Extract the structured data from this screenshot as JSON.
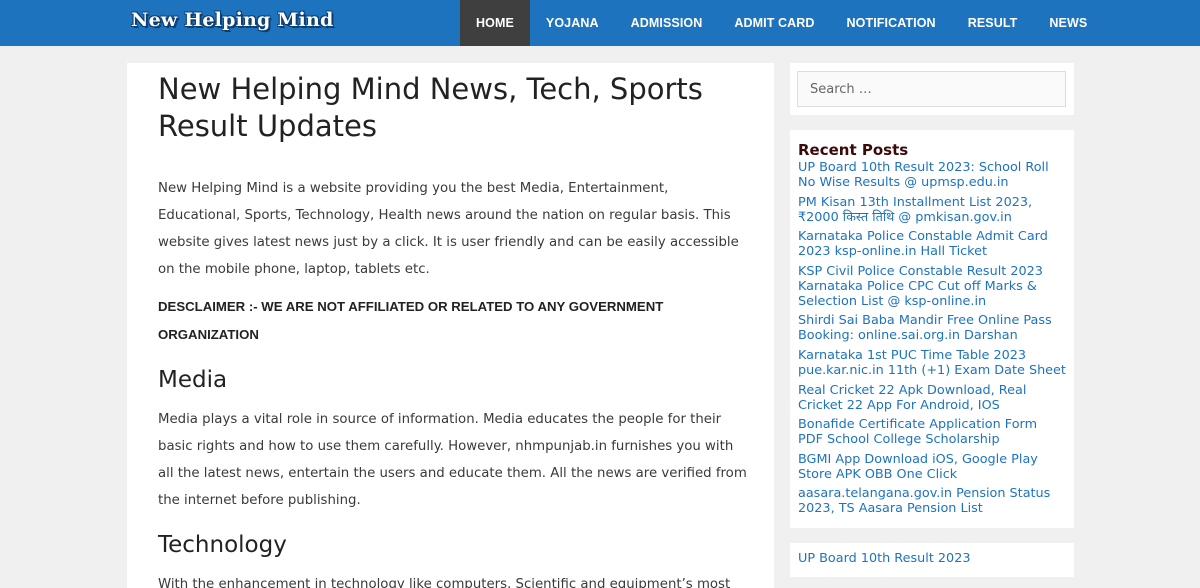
{
  "header": {
    "logo_text": "New Helping Mind",
    "nav": [
      {
        "label": "HOME",
        "active": true
      },
      {
        "label": "YOJANA"
      },
      {
        "label": "ADMISSION"
      },
      {
        "label": "ADMIT CARD"
      },
      {
        "label": "NOTIFICATION"
      },
      {
        "label": "RESULT"
      },
      {
        "label": "NEWS"
      }
    ]
  },
  "article": {
    "title": "New Helping Mind News, Tech, Sports Result Updates",
    "intro": "New Helping Mind is a website providing you the best Media, Entertainment, Educational, Sports, Technology, Health news around the nation on regular basis. This website gives latest news just by a click. It is user friendly and can be easily accessible on the mobile phone, laptop, tablets etc.",
    "disclaimer": "DESCLAIMER :- WE ARE NOT AFFILIATED OR RELATED TO ANY GOVERNMENT ORGANIZATION",
    "sections": [
      {
        "heading": "Media",
        "text": "Media plays a vital role in source of information. Media educates the people for their basic rights and how to use them carefully. However, nhmpunjab.in furnishes you with all the latest news, entertain the users and educate them. All the news are verified from the internet before publishing."
      },
      {
        "heading": "Technology",
        "text": "With the enhancement in technology like computers, Scientific and equipment’s most"
      }
    ]
  },
  "sidebar": {
    "search_placeholder": "Search …",
    "recent_title": "Recent Posts",
    "recent_posts": [
      "UP Board 10th Result 2023: School Roll No Wise Results @ upmsp.edu.in",
      "PM Kisan 13th Installment List 2023, ₹2000 किस्त तिथि @ pmkisan.gov.in",
      "Karnataka Police Constable Admit Card 2023 ksp-online.in Hall Ticket",
      "KSP Civil Police Constable Result 2023 Karnataka Police CPC Cut off Marks & Selection List @ ksp-online.in",
      "Shirdi Sai Baba Mandir Free Online Pass Booking: online.sai.org.in Darshan",
      "Karnataka 1st PUC Time Table 2023 pue.kar.nic.in 11th (+1) Exam Date Sheet",
      "Real Cricket 22 Apk Download, Real Cricket 22 App For Android, IOS",
      "Bonafide Certificate Application Form PDF School College Scholarship",
      "BGMI App Download iOS, Google Play Store APK OBB One Click",
      "aasara.telangana.gov.in Pension Status 2023, TS Aasara Pension List"
    ],
    "extra_link": "UP Board 10th Result 2023"
  },
  "colors": {
    "header_bg": "#1e73be",
    "active_nav_bg": "#3f3f3f",
    "link": "#1e73be",
    "page_bg": "#f0f0f0"
  }
}
